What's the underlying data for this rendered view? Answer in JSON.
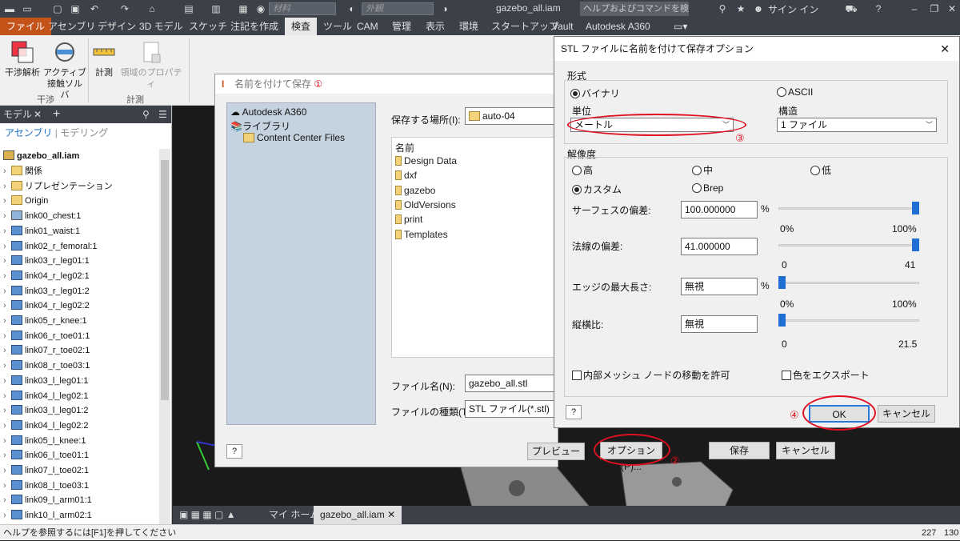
{
  "titlebar": {
    "material_dd": "材料",
    "appearance_dd": "外観",
    "doc_title": "gazebo_all.iam",
    "search_placeholder": "ヘルプおよびコマンドを検索...",
    "signin": "サイン イン"
  },
  "menu": {
    "tabs": [
      "ファイル",
      "アセンブリ",
      "デザイン",
      "3D モデル",
      "スケッチ",
      "注記を作成",
      "検査",
      "ツール",
      "CAM",
      "管理",
      "表示",
      "環境",
      "スタートアップ",
      "Vault",
      "Autodesk A360"
    ],
    "active": "検査"
  },
  "ribbon": {
    "interference": "干渉解析",
    "active_contact": "アクティブ",
    "active_contact2": "接触ソルバ",
    "measure": "計測",
    "region_props": "領域のプロパティ",
    "group1": "干渉",
    "group2": "計測"
  },
  "panel": {
    "title": "モデル",
    "assembly": "アセンブリ",
    "modeling": "モデリング",
    "root": "gazebo_all.iam",
    "items": [
      "関係",
      "リプレゼンテーション",
      "Origin",
      "link00_chest:1",
      "link01_waist:1",
      "link02_r_femoral:1",
      "link03_r_leg01:1",
      "link04_r_leg02:1",
      "link03_r_leg01:2",
      "link04_r_leg02:2",
      "link05_r_knee:1",
      "link06_r_toe01:1",
      "link07_r_toe02:1",
      "link08_r_toe03:1",
      "link03_l_leg01:1",
      "link04_l_leg02:1",
      "link03_l_leg01:2",
      "link04_l_leg02:2",
      "link05_l_knee:1",
      "link06_l_toe01:1",
      "link07_l_toe02:1",
      "link08_l_toe03:1",
      "link09_l_arm01:1",
      "link10_l_arm02:1"
    ]
  },
  "doctabs": {
    "home": "マイ ホーム",
    "doc": "gazebo_all.iam"
  },
  "status": {
    "hint": "ヘルプを参照するには[F1]を押してください",
    "n1": "227",
    "n2": "130"
  },
  "saveas": {
    "title": "名前を付けて保存",
    "mark1": "①",
    "places": [
      "Autodesk A360",
      "ライブラリ",
      "Content Center Files"
    ],
    "location_label": "保存する場所(I):",
    "location_value": "auto-04",
    "name_header": "名前",
    "files": [
      "Design Data",
      "dxf",
      "gazebo",
      "OldVersions",
      "print",
      "Templates"
    ],
    "filename_label": "ファイル名(N):",
    "filename_value": "gazebo_all.stl",
    "filetype_label": "ファイルの種類(T):",
    "filetype_value": "STL ファイル(*.stl)",
    "preview_btn": "プレビュー",
    "options_btn": "オプション(P)...",
    "mark2": "②",
    "save_btn": "保存",
    "cancel_btn": "キャンセル",
    "help": "?"
  },
  "stl": {
    "title": "STL ファイルに名前を付けて保存オプション",
    "format_label": "形式",
    "binary": "バイナリ",
    "ascii": "ASCII",
    "unit_label": "単位",
    "unit_value": "メートル",
    "structure_label": "構造",
    "structure_value": "1 ファイル",
    "mark3": "③",
    "resolution_label": "解像度",
    "high": "高",
    "medium": "中",
    "low": "低",
    "custom": "カスタム",
    "brep": "Brep",
    "surface_dev_label": "サーフェスの偏差:",
    "surface_dev_value": "100.000000",
    "pct1": "%",
    "s1_min": "0%",
    "s1_max": "100%",
    "normal_dev_label": "法線の偏差:",
    "normal_dev_value": "41.000000",
    "s2_min": "0",
    "s2_max": "41",
    "edge_label": "エッジの最大長さ:",
    "edge_value": "無視",
    "pct2": "%",
    "s3_min": "0%",
    "s3_max": "100%",
    "aspect_label": "縦横比:",
    "aspect_value": "無視",
    "s4_min": "0",
    "s4_max": "21.5",
    "allow_moving": "内部メッシュ ノードの移動を許可",
    "export_colors": "色をエクスポート",
    "mark4": "④",
    "ok": "OK",
    "cancel": "キャンセル",
    "help": "?",
    "slider_levels": [
      1.0,
      1.0,
      0.0,
      0.0
    ],
    "binary_selected": true,
    "custom_selected": true
  }
}
